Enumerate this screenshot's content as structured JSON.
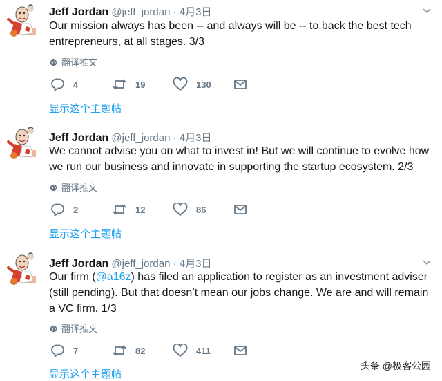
{
  "tweets": [
    {
      "name": "Jeff Jordan",
      "handle": "@jeff_jordan",
      "dot": "·",
      "date": "4月3日",
      "text_before": "Our mission always has been -- and always will be -- to back the best tech entrepreneurs, at all stages. 3/3",
      "mention": "",
      "text_after": "",
      "translate": "翻译推文",
      "replies": "4",
      "retweets": "19",
      "likes": "130",
      "thread": "显示这个主题帖"
    },
    {
      "name": "Jeff Jordan",
      "handle": "@jeff_jordan",
      "dot": "·",
      "date": "4月3日",
      "text_before": "We cannot advise you on what to invest in! But we will continue to evolve how we run our business and innovate in supporting the startup ecosystem. 2/3",
      "mention": "",
      "text_after": "",
      "translate": "翻译推文",
      "replies": "2",
      "retweets": "12",
      "likes": "86",
      "thread": "显示这个主题帖"
    },
    {
      "name": "Jeff Jordan",
      "handle": "@jeff_jordan",
      "dot": "·",
      "date": "4月3日",
      "text_before": "Our firm (",
      "mention": "@a16z",
      "text_after": ") has filed an application to register as an investment adviser (still pending). But that doesn’t mean our jobs change. We are and will remain a VC firm. 1/3",
      "translate": "翻译推文",
      "replies": "7",
      "retweets": "82",
      "likes": "411",
      "thread": "显示这个主题帖"
    }
  ],
  "watermark": "头条 @极客公园",
  "colors": {
    "link": "#1da1f2",
    "muted": "#657786",
    "text": "#14171a"
  },
  "icons": [
    "avatar",
    "chevron-down-icon",
    "globe-icon",
    "reply-icon",
    "retweet-icon",
    "heart-icon",
    "mail-icon"
  ]
}
